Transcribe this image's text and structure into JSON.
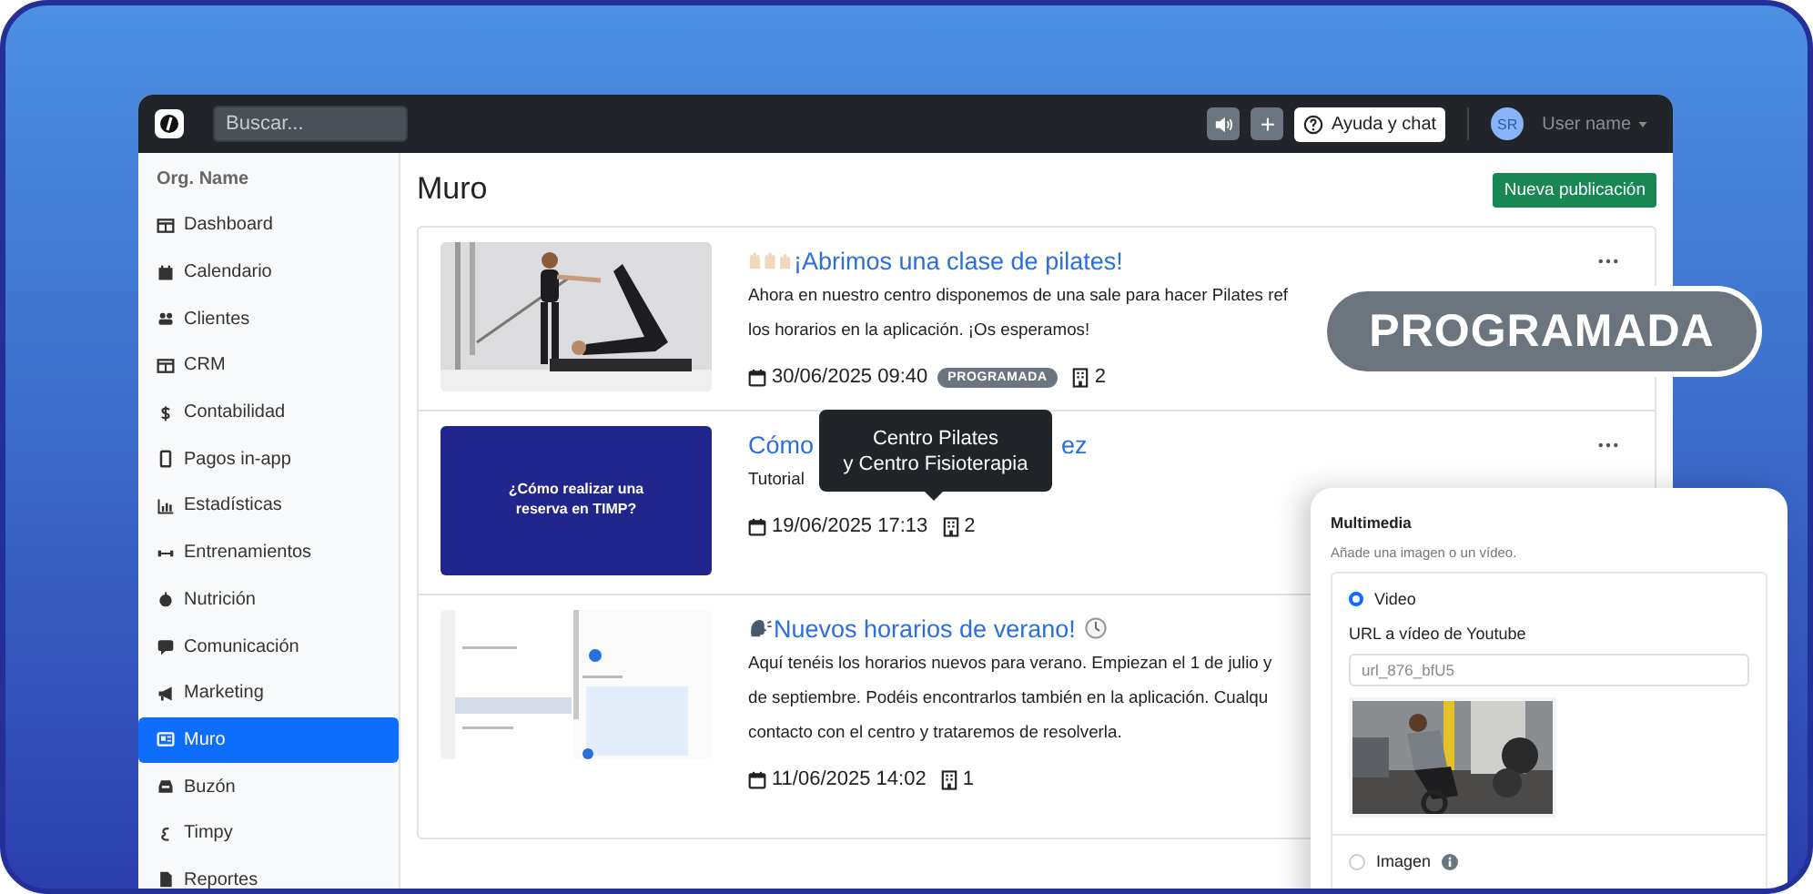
{
  "topbar": {
    "search": {
      "placeholder": "Buscar..."
    },
    "plus": "+",
    "help": "Ayuda y chat",
    "avatar": "SR",
    "user": "User name"
  },
  "sidebar": {
    "org": "Org. Name",
    "items": [
      {
        "label": "Dashboard",
        "selected": false
      },
      {
        "label": "Calendario",
        "selected": false
      },
      {
        "label": "Clientes",
        "selected": false
      },
      {
        "label": "CRM",
        "selected": false
      },
      {
        "label": "Contabilidad",
        "selected": false
      },
      {
        "label": "Pagos in-app",
        "selected": false
      },
      {
        "label": "Estadísticas",
        "selected": false
      },
      {
        "label": "Entrenamientos",
        "selected": false
      },
      {
        "label": "Nutrición",
        "selected": false
      },
      {
        "label": "Comunicación",
        "selected": false
      },
      {
        "label": "Marketing",
        "selected": false
      },
      {
        "label": "Muro",
        "selected": true
      },
      {
        "label": "Buzón",
        "selected": false
      },
      {
        "label": "Timpy",
        "selected": false
      },
      {
        "label": "Reportes",
        "selected": false
      }
    ]
  },
  "page": {
    "title": "Muro",
    "new_button": "Nueva publicación"
  },
  "posts": [
    {
      "title": "¡Abrimos una clase de pilates!",
      "lines": [
        "Ahora en nuestro centro disponemos de una sale para hacer Pilates ref",
        "los horarios en la aplicación. ¡Os esperamos!"
      ],
      "date": "30/06/2025 09:40",
      "badge": "PROGRAMADA",
      "venues": "2"
    },
    {
      "kind": "slide",
      "slide_text": "¿Cómo realizar una reserva en TIMP?",
      "title": "Cómo",
      "title_end": "ez",
      "lines": [
        "Tutorial"
      ],
      "date": "19/06/2025 17:13",
      "venues": "2"
    },
    {
      "kind": "screenshot",
      "title": "Nuevos horarios de verano!",
      "lines": [
        "Aquí tenéis los horarios nuevos para verano. Empiezan el 1 de julio y",
        "de septiembre. Podéis encontrarlos también en la aplicación. Cualqu",
        "contacto con el centro y trataremos de resolverla."
      ],
      "date": "11/06/2025 14:02",
      "venues": "1"
    }
  ],
  "tooltip": {
    "lines": [
      "Centro Pilates",
      "y Centro Fisioterapia"
    ]
  },
  "status_pill": "PROGRAMADA",
  "multimedia": {
    "title": "Multimedia",
    "hint": "Añade una imagen o un vídeo.",
    "url_label": "URL a vídeo de Youtube",
    "url_value": "url_876_bfU5",
    "options": [
      {
        "label": "Video",
        "selected": true
      },
      {
        "label": "Imagen",
        "selected": false
      }
    ]
  }
}
